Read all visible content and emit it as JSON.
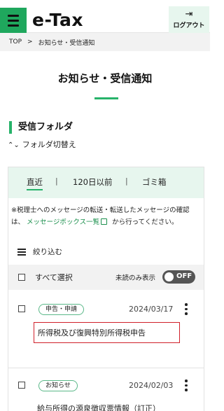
{
  "header": {
    "title": "e-Tax",
    "logout_label": "ログアウト",
    "logout_icon": "logout-icon",
    "menu_icon": "hamburger-icon"
  },
  "breadcrumb": {
    "home": "TOP",
    "separator": ">",
    "current": "お知らせ・受信通知"
  },
  "page": {
    "title": "お知らせ・受信通知"
  },
  "section": {
    "heading": "受信フォルダ",
    "folder_toggle": "フォルダ切替え",
    "folder_toggle_icon": "chevron-up-down-icon"
  },
  "tabs": {
    "items": [
      {
        "label": "直近",
        "active": true
      },
      {
        "label": "120日以前",
        "active": false
      },
      {
        "label": "ゴミ箱",
        "active": false
      }
    ],
    "separator": "|"
  },
  "notice": {
    "text_before": "※税理士へのメッセージの転送・転送したメッセージの確認は、",
    "link": "メッセージボックス一覧",
    "text_after": " から行ってください。"
  },
  "filter": {
    "label": "絞り込む",
    "icon": "filter-sliders-icon"
  },
  "select_bar": {
    "select_all": "すべて選択",
    "unread_only": "未読のみ表示",
    "toggle_state": "OFF"
  },
  "messages": [
    {
      "category": "申告・申請",
      "date": "2024/03/17",
      "subject": "所得税及び復興特別所得税申告",
      "highlighted": true
    },
    {
      "category": "お知らせ",
      "date": "2024/02/03",
      "subject": "給与所得の源泉徴収票情報（訂正）",
      "highlighted": false
    }
  ],
  "colors": {
    "accent": "#27b36a",
    "accent_light": "#e7f6ee",
    "highlight_border": "#d0202a",
    "toggle_off": "#555555"
  }
}
